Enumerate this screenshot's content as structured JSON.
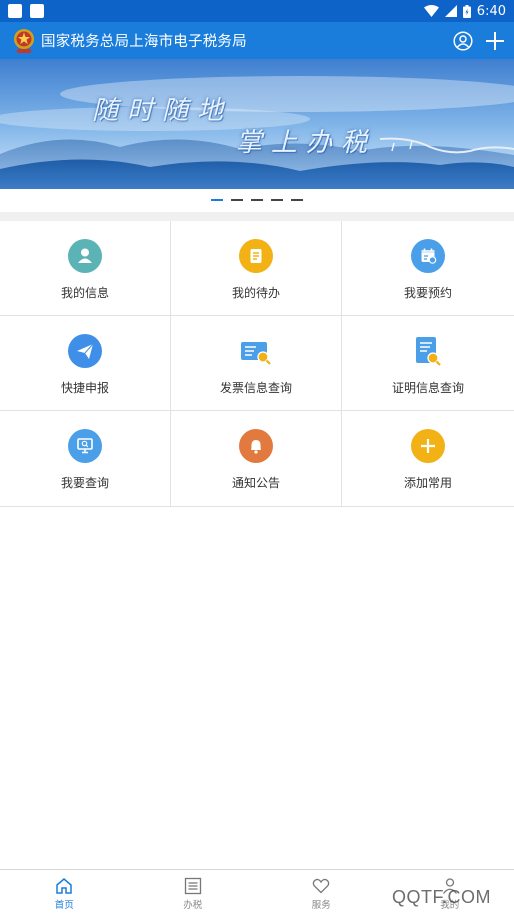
{
  "status_bar": {
    "time": "6:40"
  },
  "header": {
    "title": "国家税务总局上海市电子税务局"
  },
  "banner": {
    "line1": "随时随地",
    "line2": "掌上办税",
    "slide_count": 5,
    "active_slide": 1
  },
  "grid": {
    "items": [
      {
        "label": "我的信息",
        "icon": "user-icon",
        "color": "#5bb3b5"
      },
      {
        "label": "我的待办",
        "icon": "todo-list-icon",
        "color": "#f2b216"
      },
      {
        "label": "我要预约",
        "icon": "calendar-icon",
        "color": "#4a9fe8"
      },
      {
        "label": "快捷申报",
        "icon": "paper-plane-icon",
        "color": "#3f8fe8"
      },
      {
        "label": "发票信息查询",
        "icon": "invoice-search-icon",
        "color": "#4a9fe8"
      },
      {
        "label": "证明信息查询",
        "icon": "certificate-search-icon",
        "color": "#4a9fe8"
      },
      {
        "label": "我要查询",
        "icon": "monitor-search-icon",
        "color": "#4a9fe8"
      },
      {
        "label": "通知公告",
        "icon": "bell-icon",
        "color": "#e27a3f"
      },
      {
        "label": "添加常用",
        "icon": "plus-icon",
        "color": "#f2b216"
      }
    ]
  },
  "bottom_nav": {
    "items": [
      {
        "label": "首页",
        "icon": "home-icon",
        "active": true
      },
      {
        "label": "办税",
        "icon": "list-icon",
        "active": false
      },
      {
        "label": "服务",
        "icon": "heart-icon",
        "active": false
      },
      {
        "label": "我的",
        "icon": "person-icon",
        "active": false
      }
    ]
  },
  "watermark": "QQTF.COM",
  "colors": {
    "status_bar": "#0d63c7",
    "header": "#1a7ddb",
    "accent": "#1a7ddb"
  }
}
